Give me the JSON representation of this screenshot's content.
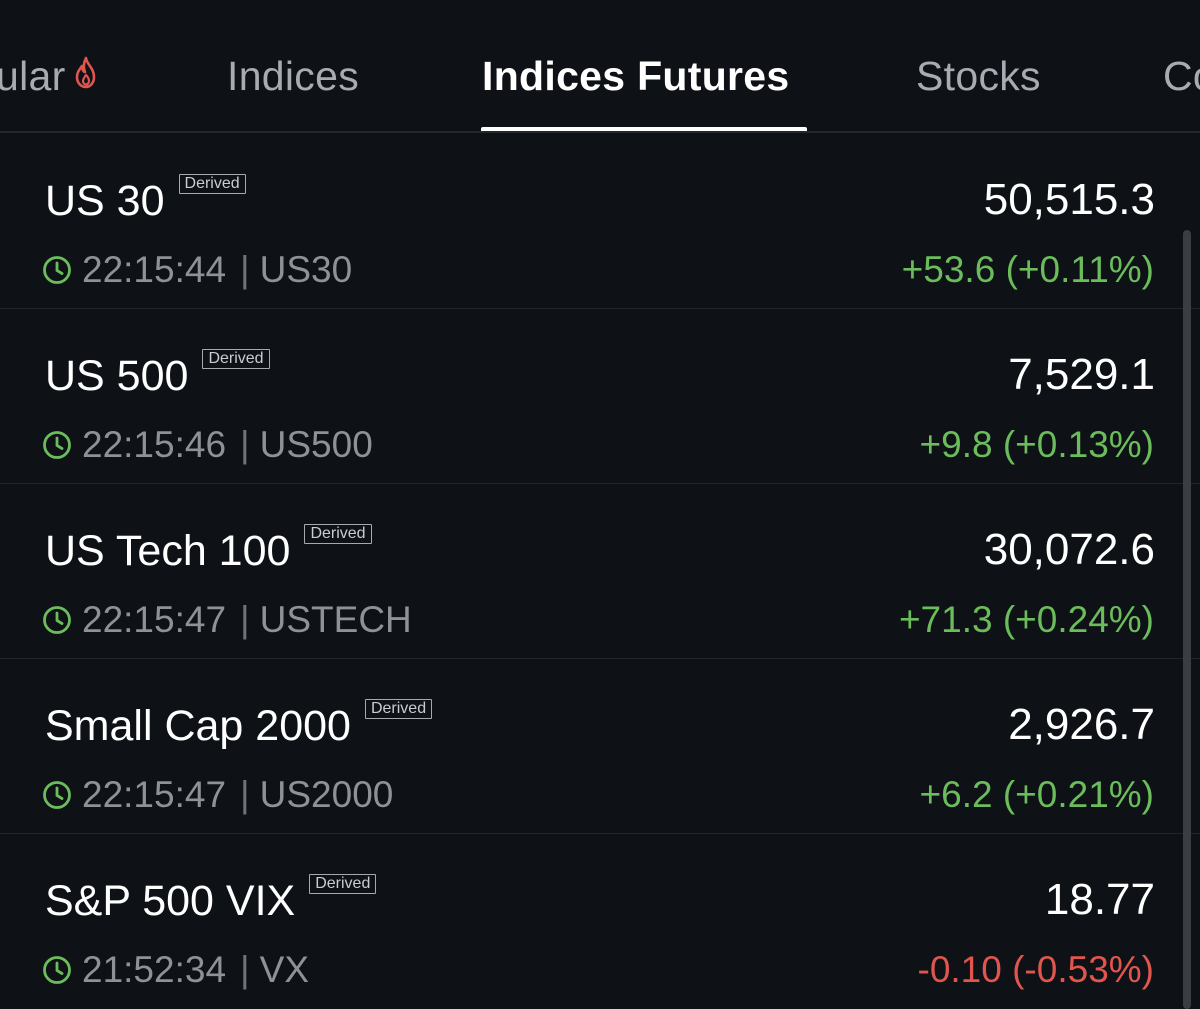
{
  "tabs": [
    {
      "label": "ular"
    },
    {
      "label": "Indices"
    },
    {
      "label": "Indices Futures",
      "active": true
    },
    {
      "label": "Stocks"
    },
    {
      "label": "Co"
    }
  ],
  "badge_label": "Derived",
  "rows": [
    {
      "name": "US 30",
      "time": "22:15:44",
      "symbol": "US30",
      "price": "50,515.3",
      "change": "+53.6 (+0.11%)",
      "direction": "up"
    },
    {
      "name": "US 500",
      "time": "22:15:46",
      "symbol": "US500",
      "price": "7,529.1",
      "change": "+9.8 (+0.13%)",
      "direction": "up"
    },
    {
      "name": "US Tech 100",
      "time": "22:15:47",
      "symbol": "USTECH",
      "price": "30,072.6",
      "change": "+71.3 (+0.24%)",
      "direction": "up"
    },
    {
      "name": "Small Cap 2000",
      "time": "22:15:47",
      "symbol": "US2000",
      "price": "2,926.7",
      "change": "+6.2 (+0.21%)",
      "direction": "up"
    },
    {
      "name": "S&P 500 VIX",
      "time": "21:52:34",
      "symbol": "VX",
      "price": "18.77",
      "change": "-0.10 (-0.53%)",
      "direction": "down"
    }
  ],
  "separator": "|",
  "colors": {
    "background": "#0e1116",
    "positive": "#6bbd5c",
    "negative": "#e0564f",
    "clock_icon": "#6bbd5c",
    "hot_icon": "#e0564f"
  },
  "icons": {
    "hot": "fire-icon",
    "time": "clock-icon"
  }
}
